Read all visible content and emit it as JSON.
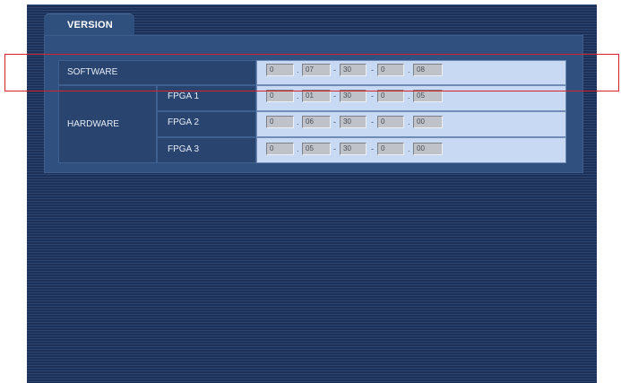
{
  "tab": {
    "label": "VERSION"
  },
  "software": {
    "label": "SOFTWARE",
    "fields": [
      "0",
      "07",
      "30",
      "0",
      "08"
    ]
  },
  "hardware": {
    "label": "HARDWARE",
    "rows": [
      {
        "label": "FPGA 1",
        "fields": [
          "0",
          "01",
          "30",
          "0",
          "05"
        ]
      },
      {
        "label": "FPGA 2",
        "fields": [
          "0",
          "06",
          "30",
          "0",
          "00"
        ]
      },
      {
        "label": "FPGA 3",
        "fields": [
          "0",
          "05",
          "30",
          "0",
          "00"
        ]
      }
    ]
  },
  "separators": [
    ".",
    "-",
    "-",
    "."
  ],
  "colors": {
    "highlight": "#d8222a",
    "panel": "#233a62",
    "value_bg": "#c8daf3"
  }
}
